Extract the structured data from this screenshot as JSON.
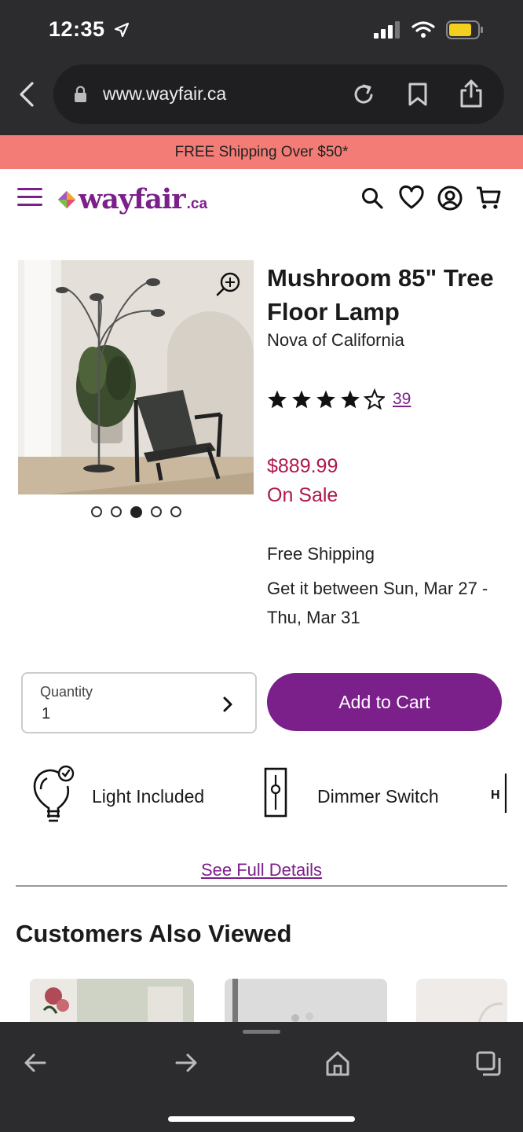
{
  "status_bar": {
    "time": "12:35"
  },
  "browser": {
    "url": "www.wayfair.ca"
  },
  "promo": {
    "text": "FREE Shipping Over $50*"
  },
  "site": {
    "logo": "wayfair",
    "logo_suffix": ".ca"
  },
  "product": {
    "title": "Mushroom 85\" Tree Floor Lamp",
    "brand": "Nova of California",
    "rating": 4.5,
    "review_count": "39",
    "price": "$889.99",
    "sale_label": "On Sale",
    "shipping_title": "Free Shipping",
    "delivery": "Get it between Sun, Mar 27 - Thu, Mar 31",
    "image_count": 5,
    "active_image": 3
  },
  "quantity": {
    "label": "Quantity",
    "value": "1"
  },
  "add_to_cart": "Add to Cart",
  "features": [
    {
      "label": "Light Included",
      "icon": "lightbulb-check-icon"
    },
    {
      "label": "Dimmer Switch",
      "icon": "dimmer-switch-icon"
    }
  ],
  "see_full_details": "See Full Details",
  "customers_also_viewed": "Customers Also Viewed",
  "colors": {
    "brand": "#7b1f8a",
    "sale": "#b0174f",
    "promo_bg": "#f47c77",
    "chrome": "#2c2c2e"
  }
}
